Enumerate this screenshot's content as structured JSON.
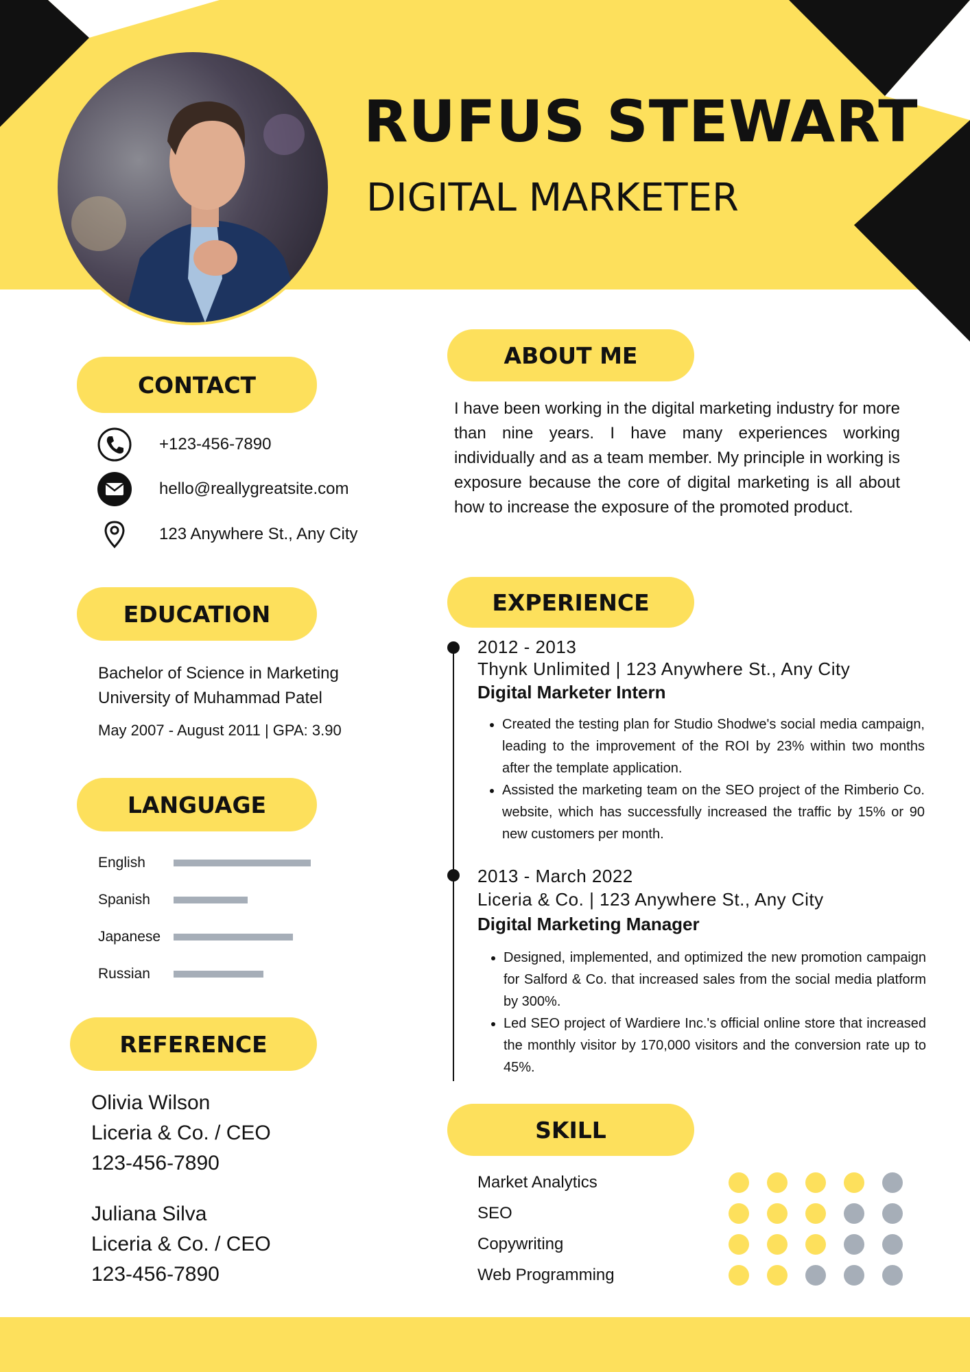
{
  "colors": {
    "accent": "#fde05c",
    "dark": "#111111",
    "muted": "#a6aeb8"
  },
  "header": {
    "name": "RUFUS STEWART",
    "title": "DIGITAL MARKETER"
  },
  "contact": {
    "heading": "CONTACT",
    "items": [
      {
        "icon": "phone-icon",
        "text": "+123-456-7890"
      },
      {
        "icon": "email-icon",
        "text": "hello@reallygreatsite.com"
      },
      {
        "icon": "location-pin-icon",
        "text": "123 Anywhere St., Any City"
      }
    ]
  },
  "education": {
    "heading": "EDUCATION",
    "degree": "Bachelor of Science in Marketing",
    "school": "University of Muhammad Patel",
    "period": "May 2007 - August 2011 | GPA: 3.90"
  },
  "language": {
    "heading": "LANGUAGE",
    "items": [
      {
        "name": "English",
        "level": 0.78
      },
      {
        "name": "Spanish",
        "level": 0.42
      },
      {
        "name": "Japanese",
        "level": 0.68
      },
      {
        "name": "Russian",
        "level": 0.51
      }
    ]
  },
  "reference": {
    "heading": "REFERENCE",
    "items": [
      {
        "name": "Olivia Wilson",
        "role": "Liceria & Co. / CEO",
        "phone": "123-456-7890"
      },
      {
        "name": "Juliana Silva",
        "role": "Liceria & Co. / CEO",
        "phone": "123-456-7890"
      }
    ]
  },
  "about": {
    "heading": "ABOUT ME",
    "text": "I have been working in the digital marketing industry for more than nine years. I have many experiences working individually and as a team member. My principle in working is exposure because the core of digital marketing is all about how to increase the exposure of the promoted product."
  },
  "experience": {
    "heading": "EXPERIENCE",
    "items": [
      {
        "date": "2012 - 2013",
        "company": "Thynk Unlimited | 123 Anywhere St., Any City",
        "role": "Digital Marketer Intern",
        "bullets": [
          "Created the testing plan for Studio Shodwe's social media campaign, leading to the improvement of the ROI by 23% within two months after the template application.",
          "Assisted the marketing team on the SEO project of the Rimberio Co. website, which has successfully increased the traffic by 15% or 90 new customers per month."
        ]
      },
      {
        "date": "2013 - March 2022",
        "company": "Liceria & Co. | 123 Anywhere St., Any City",
        "role": "Digital Marketing Manager",
        "bullets": [
          "Designed, implemented, and optimized the new promotion campaign for Salford & Co. that increased sales from the social media platform by 300%.",
          "Led SEO project of Wardiere Inc.'s official online store that increased the monthly visitor by 170,000 visitors and the conversion rate up to 45%."
        ]
      }
    ]
  },
  "skill": {
    "heading": "SKILL",
    "max": 5,
    "items": [
      {
        "name": "Market Analytics",
        "rating": 4
      },
      {
        "name": "SEO",
        "rating": 3
      },
      {
        "name": "Copywriting",
        "rating": 3
      },
      {
        "name": "Web Programming",
        "rating": 2
      }
    ]
  }
}
